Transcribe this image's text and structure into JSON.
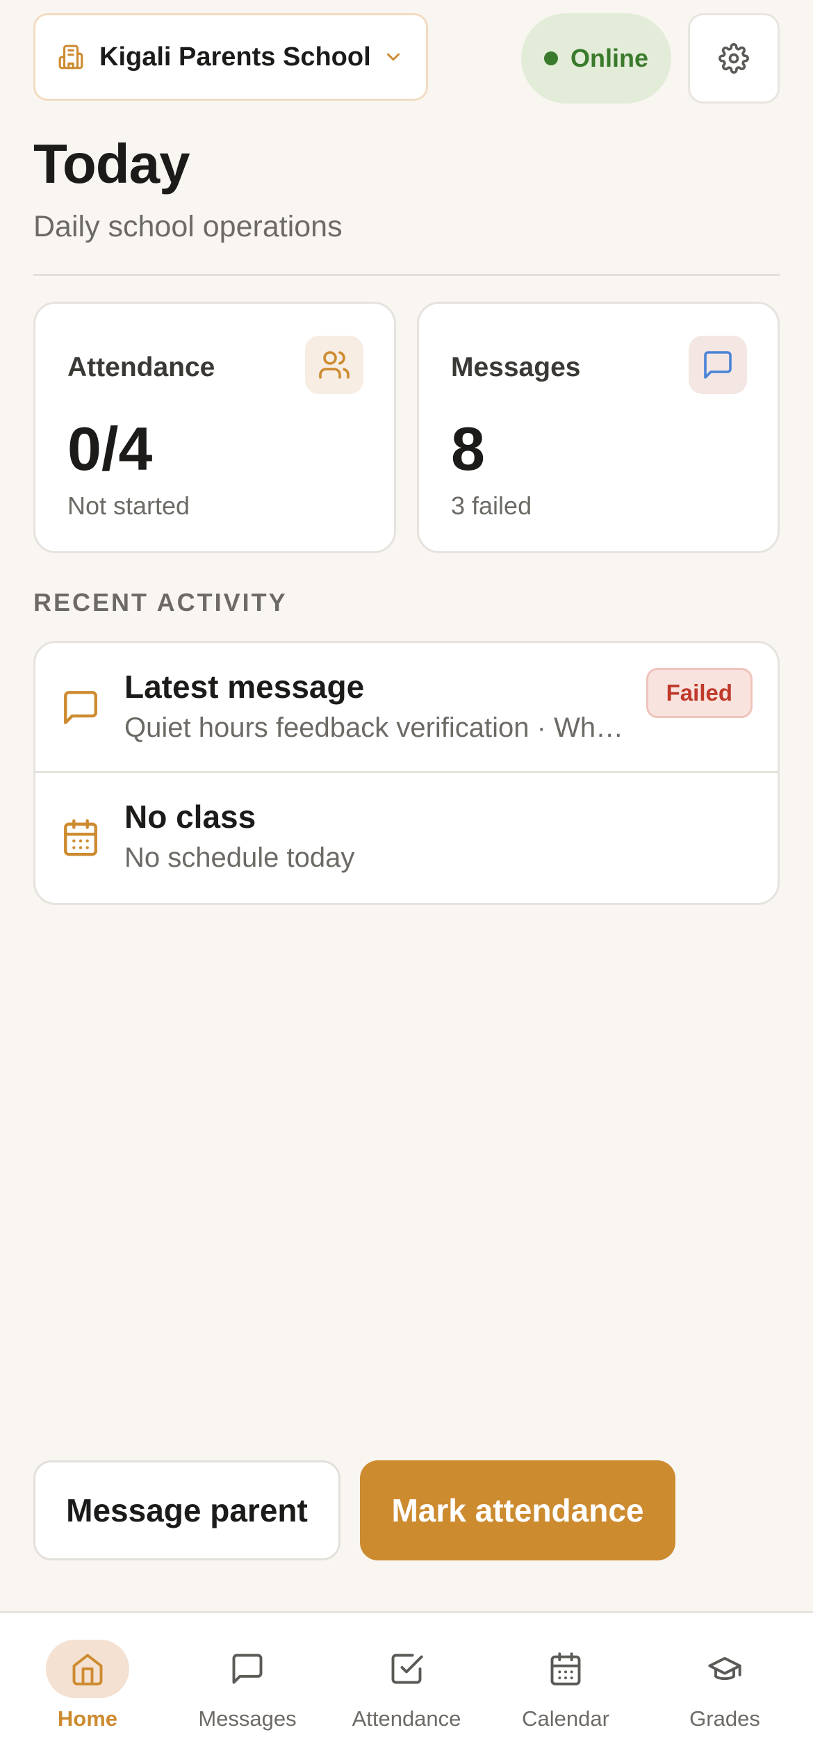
{
  "colors": {
    "accent": "#cd8b30",
    "online": "#3a7a2c",
    "failed": "#c0392b",
    "message_icon": "#4a84d6",
    "background": "#f9f6f1"
  },
  "header": {
    "school_name": "Kigali Parents School",
    "school_icon": "building-icon",
    "status": "Online",
    "settings_icon": "gear-icon"
  },
  "page": {
    "title": "Today",
    "subtitle": "Daily school operations"
  },
  "cards": {
    "attendance": {
      "label": "Attendance",
      "value": "0/4",
      "note": "Not started",
      "icon": "users-icon"
    },
    "messages": {
      "label": "Messages",
      "value": "8",
      "note": "3 failed",
      "icon": "chat-icon"
    }
  },
  "recent": {
    "heading": "RECENT ACTIVITY",
    "items": [
      {
        "title": "Latest message",
        "detail": "Quiet hours feedback verification · Wh…",
        "badge": "Failed",
        "icon": "chat-icon"
      },
      {
        "title": "No class",
        "detail": "No schedule today",
        "icon": "calendar-icon"
      }
    ]
  },
  "actions": {
    "secondary": "Message parent",
    "primary": "Mark attendance"
  },
  "tabs": [
    {
      "label": "Home",
      "icon": "home-icon",
      "active": true
    },
    {
      "label": "Messages",
      "icon": "chat-icon"
    },
    {
      "label": "Attendance",
      "icon": "checkbox-icon"
    },
    {
      "label": "Calendar",
      "icon": "calendar-icon"
    },
    {
      "label": "Grades",
      "icon": "graduation-cap-icon"
    }
  ]
}
